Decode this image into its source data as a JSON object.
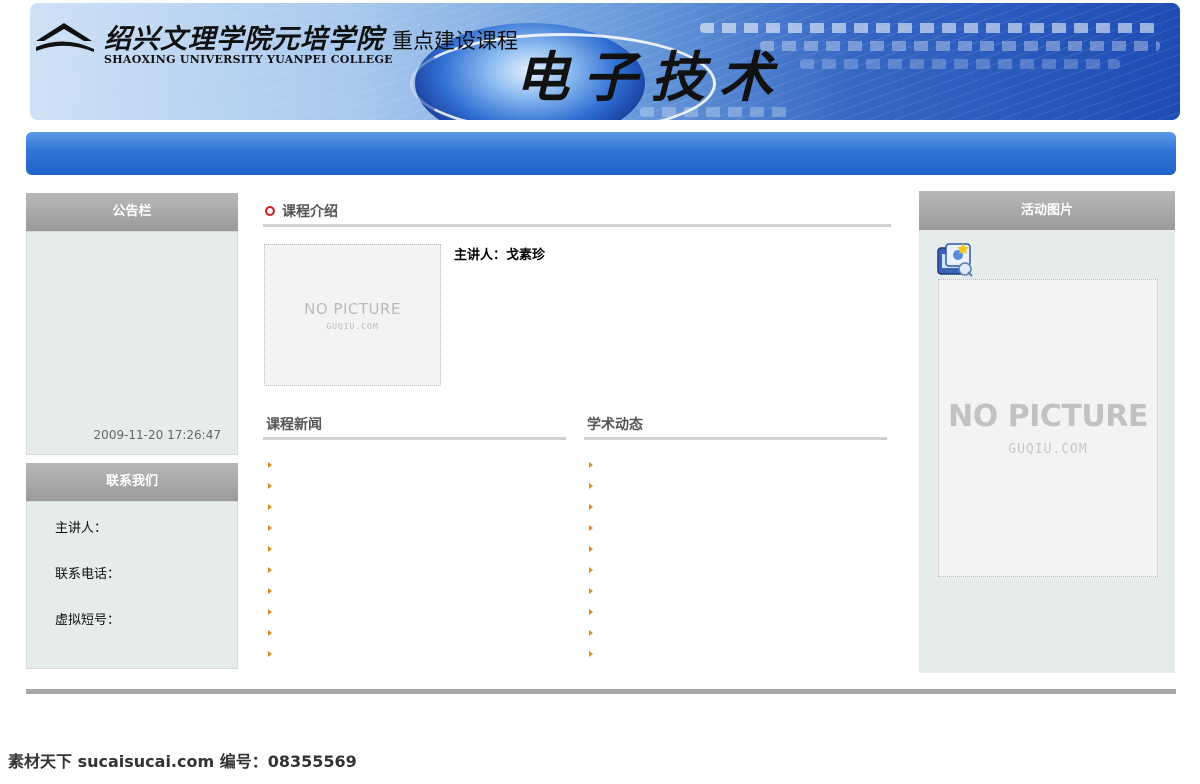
{
  "header": {
    "university_cn": "绍兴文理学院元培学院",
    "course_tag": "重点建设课程",
    "university_en": "SHAOXING UNIVERSITY YUANPEI COLLEGE",
    "course_title": "电子技术"
  },
  "sidebar": {
    "notice": {
      "title": "公告栏",
      "timestamp": "2009-11-20 17:26:47"
    },
    "contact": {
      "title": "联系我们",
      "rows": [
        "主讲人：",
        "联系电话：",
        "虚拟短号："
      ]
    }
  },
  "main": {
    "intro": {
      "title": "课程介绍",
      "lecturer": "主讲人：戈素珍",
      "placeholder_big": "NO PICTURE",
      "placeholder_small": "GUQIU.COM"
    },
    "news": {
      "title": "课程新闻",
      "item_count": 10
    },
    "academic": {
      "title": "学术动态",
      "item_count": 10
    }
  },
  "right": {
    "activity": {
      "title": "活动图片",
      "placeholder_big": "NO PICTURE",
      "placeholder_small": "GUQIU.COM"
    }
  },
  "watermark": "素材天下 sucaisucai.com  编号：08355569",
  "colors": {
    "nav_blue": "#2f74d6",
    "panel_bg": "#e6eceb",
    "header_gray": "#9a9a9a",
    "bullet_orange": "#e08a1e",
    "intro_dot_red": "#c81e1e"
  }
}
